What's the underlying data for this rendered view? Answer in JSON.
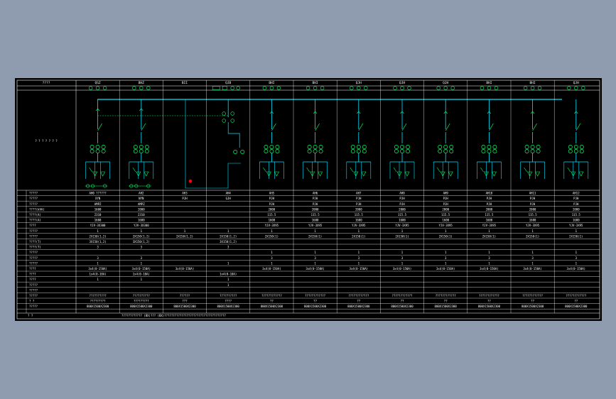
{
  "colors": {
    "background": "#8f9caf",
    "canvas": "#000000",
    "bus": "#00e5ff",
    "device": "#00ff66",
    "grid": "#ffffff",
    "marker": "#ff0000",
    "tie_line": "#00ff66"
  },
  "header": {
    "label": "????",
    "panels": [
      "QSZ",
      "BHZ",
      "BII",
      "QJB",
      "BHI",
      "BHI",
      "QJH",
      "QJH",
      "QJH",
      "BHI",
      "BHI",
      "QJH"
    ]
  },
  "scheme_label": "? ? ? ? ? ? ?",
  "rows": [
    {
      "label": "?????",
      "values": [
        "AH0 ??????",
        "AH2",
        "AH3",
        "AH4",
        "AH5",
        "AH6",
        "AH7",
        "AH8",
        "AH9",
        "AH10",
        "AH11",
        "AH12"
      ]
    },
    {
      "label": "?????",
      "values": [
        "XYN",
        "NYN",
        "PJH",
        "GJH",
        "PJH",
        "PJH",
        "PJH",
        "PJH",
        "PJH",
        "PJH",
        "PJH",
        "PJH"
      ]
    },
    {
      "label": "?????",
      "values": [
        "AMPZ",
        "AMPZ",
        "",
        "",
        "PJH",
        "PJH",
        "PJH",
        "PJH",
        "PJH",
        "PJH",
        "PJH",
        "PJH"
      ]
    },
    {
      "label": "????(kVA)",
      "values": [
        "1600",
        "2000",
        "",
        "",
        "2000",
        "2000",
        "2000",
        "2000",
        "2000",
        "2000",
        "2000",
        "2000"
      ]
    },
    {
      "label": "????(A)",
      "values": [
        "2310",
        "2310",
        "",
        "",
        "115.5",
        "115.5",
        "115.5",
        "115.5",
        "115.5",
        "115.5",
        "115.5",
        "115.5"
      ]
    },
    {
      "label": "????(A)",
      "values": [
        "1600",
        "1600",
        "",
        "",
        "1600",
        "1600",
        "1600",
        "1600",
        "1600",
        "1600",
        "1600",
        "1600"
      ]
    },
    {
      "label": "????",
      "values": [
        "YJV-3X300",
        "YJV-3X300",
        "",
        "",
        "YJV-3X95",
        "YJV-3X95",
        "YJV-3X95",
        "YJV-3X95",
        "YJV-3X95",
        "YJV-3X95",
        "YJV-3X95",
        "YJV-3X95"
      ]
    },
    {
      "label": "?????",
      "values": [
        "1",
        "1",
        "1",
        "1",
        "1",
        "1",
        "1",
        "1",
        "1",
        "1",
        "1",
        "1"
      ]
    },
    {
      "label": "?????",
      "values": [
        "2X150(1,2)",
        "2X150(1,2)",
        "2X150(1,2)",
        "2X150(1,2)",
        "2X150(1)",
        "2X150(1)",
        "2X150(1)",
        "2X150(1)",
        "2X150(1)",
        "2X150(1)",
        "2X150(1)",
        "2X150(1)"
      ]
    },
    {
      "label": "????(T)",
      "values": [
        "3X150(1,2)",
        "3X150(1,2)",
        "",
        "3X150(1,2)",
        "",
        "",
        "",
        "",
        "",
        "",
        "",
        ""
      ]
    },
    {
      "label": "????(T)",
      "values": [
        "3",
        "3",
        "",
        "3",
        "",
        "",
        "",
        "",
        "",
        "",
        "",
        ""
      ]
    },
    {
      "label": "?????",
      "values": [
        "",
        "",
        "",
        "",
        "1",
        "1",
        "1",
        "1",
        "1",
        "1",
        "1",
        "1"
      ]
    },
    {
      "label": "?????",
      "values": [
        "3",
        "3",
        "",
        "",
        "3",
        "3",
        "3",
        "3",
        "3",
        "3",
        "3",
        "3"
      ]
    },
    {
      "label": "?????",
      "values": [
        "1",
        "1",
        "",
        "1",
        "1",
        "1",
        "1",
        "1",
        "1",
        "1",
        "1",
        "1"
      ]
    },
    {
      "label": "????",
      "values": [
        "3x4(0-150A)",
        "3x4(0-150A)",
        "3x4(0-150A)",
        "",
        "3x4(0-150A)",
        "3x4(0-150A)",
        "3x4(0-150A)",
        "3x4(0-150A)",
        "3x4(0-150A)",
        "3x4(0-150A)",
        "3x4(0-150A)",
        "3x4(0-150A)"
      ]
    },
    {
      "label": "????",
      "values": [
        "1x4(0-10A)",
        "1x4(0-10A)",
        "",
        "1x4(0-10A)",
        "",
        "",
        "",
        "",
        "",
        "",
        "",
        ""
      ]
    },
    {
      "label": "????",
      "values": [
        "1",
        "1",
        "",
        "1",
        "",
        "",
        "",
        "",
        "",
        "",
        "",
        ""
      ]
    },
    {
      "label": "?????",
      "values": [
        "",
        "",
        "",
        "1",
        "",
        "",
        "",
        "",
        "",
        "",
        "",
        ""
      ]
    },
    {
      "label": "?????",
      "values": [
        "",
        "",
        "",
        "",
        "",
        "",
        "",
        "",
        "",
        "",
        "",
        ""
      ]
    },
    {
      "label": "?????",
      "values": [
        "??????????",
        "??????????",
        "??????",
        "??????????",
        "????????????",
        "????????????",
        "????????????",
        "????????????",
        "????????????",
        "????????????",
        "????????????",
        "????????????"
      ]
    },
    {
      "label": "? ?",
      "values": [
        "?????????",
        "?????????",
        "???",
        "????",
        "??",
        "??",
        "??",
        "??",
        "??",
        "??",
        "??",
        "??"
      ]
    },
    {
      "label": "?????",
      "values": [
        "800X1500X2300",
        "800X1500X2300",
        "800X1500X2300",
        "800X1500X2300",
        "800X1500X2300",
        "800X1500X2300",
        "800X1500X2300",
        "800X1500X2300",
        "800X1500X2300",
        "800X1500X2300",
        "800X1500X2300",
        "800X1500X2300"
      ]
    }
  ],
  "footer": {
    "label": "? ?",
    "text": "???????????? (BX)??? (BX)????????????????????????????????????"
  }
}
